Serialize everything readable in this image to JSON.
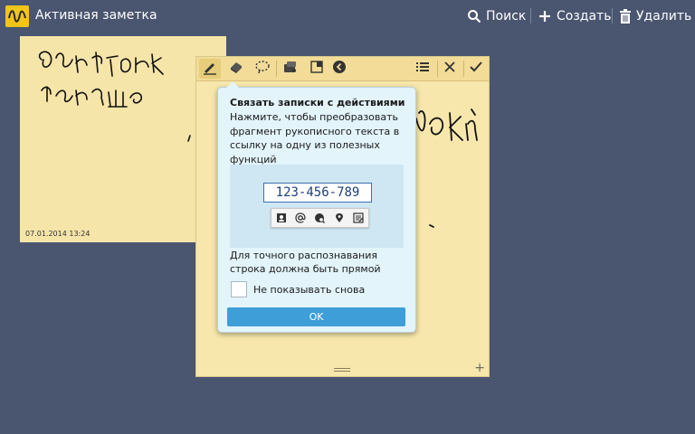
{
  "app": {
    "title": "Активная заметка",
    "icon": "s-note-app-icon",
    "accent": "#f2c619"
  },
  "actions": {
    "search": {
      "label": "Поиск",
      "icon": "search-icon"
    },
    "create": {
      "label": "Создать",
      "icon": "plus-icon"
    },
    "delete": {
      "label": "Удалить",
      "icon": "trash-icon"
    }
  },
  "back_note": {
    "date": "07.01.2014 13:24",
    "color": "#f6e5a8"
  },
  "front_note": {
    "color": "#f7e7ac",
    "toolbar": {
      "icons": [
        "pen-icon",
        "eraser-icon",
        "lasso-select-icon",
        "paint-icon",
        "crop-icon",
        "collapse-icon",
        "list-icon",
        "close-icon",
        "check-icon"
      ]
    }
  },
  "popup": {
    "title": "Связать записки с действиями",
    "description": "Нажмите, чтобы преобразовать фрагмент рукописного текста в ссылку на одну из полезных функций",
    "demo_number": "123-456-789",
    "demo_icons": [
      "contact-icon",
      "email-icon",
      "web-icon",
      "location-icon",
      "task-icon"
    ],
    "note": "Для точного распознавания строка должна быть прямой",
    "checkbox_label": "Не показывать снова",
    "checkbox_checked": false,
    "ok_label": "OK",
    "button_color": "#3d9ed8"
  }
}
